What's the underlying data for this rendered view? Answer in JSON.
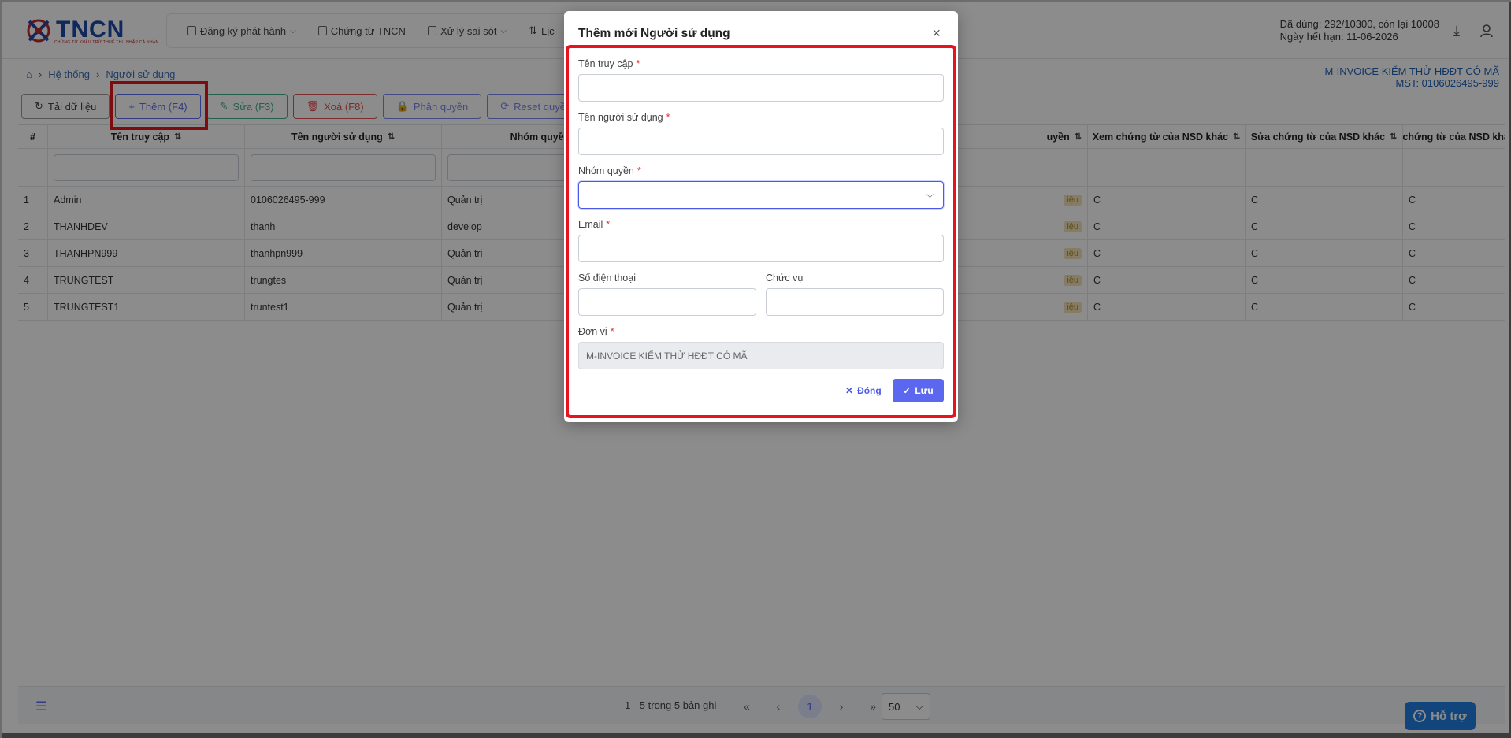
{
  "header": {
    "logo_text": "TNCN",
    "logo_tagline": "CHỨNG TỪ KHẤU TRỪ THUẾ THU NHẬP CÁ NHÂN",
    "menu": [
      {
        "label": "Đăng ký phát hành",
        "icon": "document-icon",
        "has_dropdown": true
      },
      {
        "label": "Chứng từ TNCN",
        "icon": "document-icon",
        "has_dropdown": false
      },
      {
        "label": "Xử lý sai sót",
        "icon": "document-icon",
        "has_dropdown": true
      },
      {
        "label": "Lịc",
        "icon": "sort-icon",
        "has_dropdown": false
      }
    ],
    "usage_line1": "Đã dùng: 292/10300, còn lại 10008",
    "usage_line2": "Ngày hết hạn: 11-06-2026"
  },
  "breadcrumb": {
    "items": [
      "Hệ thống",
      "Người sử dụng"
    ]
  },
  "company": {
    "name": "M-INVOICE KIỂM THỬ HĐĐT CÓ MÃ",
    "tax_code": "MST: 0106026495-999"
  },
  "toolbar": {
    "reload": "Tải dữ liệu",
    "add": "Thêm (F4)",
    "edit": "Sửa (F3)",
    "delete": "Xoá (F8)",
    "permission": "Phân quyền",
    "reset": "Reset quyền n"
  },
  "table": {
    "headers": [
      "#",
      "Tên truy cập",
      "Tên người sử dụng",
      "Nhóm quyền",
      "uyền",
      "Xem chứng từ của NSD khác",
      "Sửa chứng từ của NSD khác",
      "Xóa chứng từ của NSD khác"
    ],
    "rows": [
      {
        "no": "1",
        "username": "Admin",
        "fullname": "0106026495-999",
        "group": "Quản trị",
        "badge": "iệu",
        "view": "C",
        "edit": "C",
        "delete": "C"
      },
      {
        "no": "2",
        "username": "THANHDEV",
        "fullname": "thanh",
        "group": "develop",
        "badge": "iệu",
        "view": "C",
        "edit": "C",
        "delete": "C"
      },
      {
        "no": "3",
        "username": "THANHPN999",
        "fullname": "thanhpn999",
        "group": "Quản trị",
        "badge": "iệu",
        "view": "C",
        "edit": "C",
        "delete": "C"
      },
      {
        "no": "4",
        "username": "TRUNGTEST",
        "fullname": "trungtes",
        "group": "Quản trị",
        "badge": "iệu",
        "view": "C",
        "edit": "C",
        "delete": "C"
      },
      {
        "no": "5",
        "username": "TRUNGTEST1",
        "fullname": "truntest1",
        "group": "Quản trị",
        "badge": "iệu",
        "view": "C",
        "edit": "C",
        "delete": "C"
      }
    ]
  },
  "pager": {
    "info": "1 - 5 trong 5 bản ghi",
    "current_page": "1",
    "page_size": "50"
  },
  "support": {
    "label": "Hỗ trợ"
  },
  "modal": {
    "title": "Thêm mới Người sử dụng",
    "fields": {
      "username_label": "Tên truy cập",
      "fullname_label": "Tên người sử dụng",
      "group_label": "Nhóm quyền",
      "email_label": "Email",
      "phone_label": "Số điện thoại",
      "position_label": "Chức vụ",
      "unit_label": "Đơn vị",
      "unit_value": "M-INVOICE KIỂM THỬ HĐĐT CÓ MÃ"
    },
    "close_label": "Đóng",
    "save_label": "Lưu"
  },
  "colors": {
    "accent": "#5b67ef",
    "highlight": "#e8141d",
    "brand": "#1e4aa8",
    "support": "#1f7fe0"
  }
}
